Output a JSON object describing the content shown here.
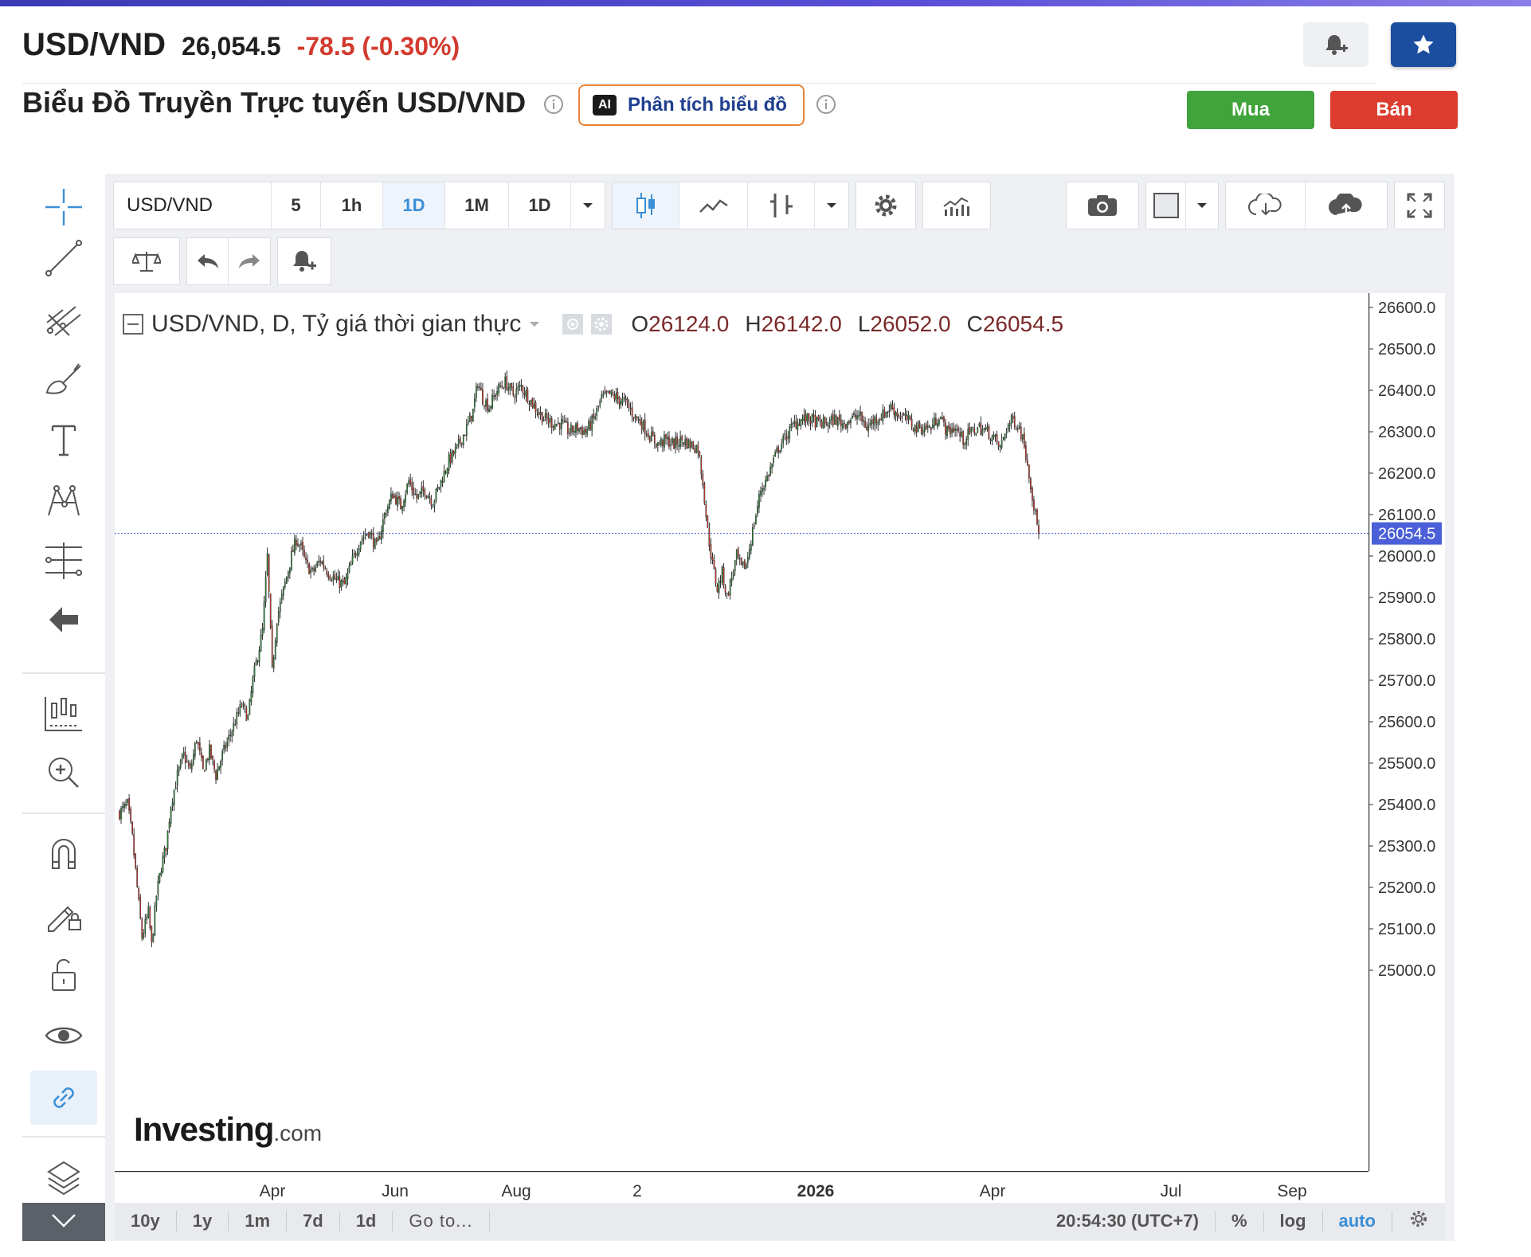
{
  "header": {
    "symbol": "USD/VND",
    "last_price": "26,054.5",
    "change": "-78.5",
    "change_pct": "(-0.30%)"
  },
  "subtitle": "Biểu Đồ Truyền Trực tuyến USD/VND",
  "ai_button": {
    "badge": "AI",
    "label": "Phân tích biểu đồ"
  },
  "actions": {
    "buy": "Mua",
    "sell": "Bán"
  },
  "toolbar": {
    "symbol": "USD/VND",
    "intervals": [
      "5",
      "1h",
      "1D",
      "1M",
      "1D"
    ],
    "selected_interval": "1D"
  },
  "legend": {
    "title": "USD/VND, D, Tỷ giá thời gian thực",
    "o_label": "O",
    "o_value": "26124.0",
    "h_label": "H",
    "h_value": "26142.0",
    "l_label": "L",
    "l_value": "26052.0",
    "c_label": "C",
    "c_value": "26054.5"
  },
  "watermark": {
    "brand": "Investing",
    "suffix": ".com"
  },
  "bottom_bar": {
    "ranges": [
      "10y",
      "1y",
      "1m",
      "7d",
      "1d"
    ],
    "goto": "Go to...",
    "clock": "20:54:30 (UTC+7)",
    "percent": "%",
    "log": "log",
    "auto": "auto"
  },
  "colors": {
    "up": "#2e8b3a",
    "down": "#d23b2e",
    "accent": "#3b5bdb",
    "price_tag": "#4a5fd8"
  },
  "chart_data": {
    "type": "candlestick",
    "symbol": "USD/VND",
    "interval": "D",
    "ylim": [
      24950,
      26650
    ],
    "y_ticks": [
      "26600.0",
      "26500.0",
      "26400.0",
      "26300.0",
      "26200.0",
      "26100.0",
      "26000.0",
      "25900.0",
      "25800.0",
      "25700.0",
      "25600.0",
      "25500.0",
      "25400.0",
      "25300.0",
      "25200.0",
      "25100.0",
      "25000.0"
    ],
    "x_ticks": [
      "Apr",
      "Jun",
      "Aug",
      "2",
      "2026",
      "Apr",
      "Jul",
      "Sep"
    ],
    "last_price_label": "26054.5",
    "last_price": 26054.5,
    "close_path": [
      [
        0,
        25380
      ],
      [
        5,
        25400
      ],
      [
        8,
        25320
      ],
      [
        11,
        25200
      ],
      [
        14,
        25080
      ],
      [
        18,
        25140
      ],
      [
        20,
        25060
      ],
      [
        23,
        25180
      ],
      [
        26,
        25250
      ],
      [
        29,
        25300
      ],
      [
        32,
        25400
      ],
      [
        36,
        25470
      ],
      [
        40,
        25520
      ],
      [
        44,
        25480
      ],
      [
        48,
        25560
      ],
      [
        52,
        25480
      ],
      [
        56,
        25530
      ],
      [
        60,
        25470
      ],
      [
        64,
        25520
      ],
      [
        68,
        25560
      ],
      [
        72,
        25600
      ],
      [
        76,
        25640
      ],
      [
        80,
        25610
      ],
      [
        83,
        25700
      ],
      [
        86,
        25760
      ],
      [
        89,
        25820
      ],
      [
        92,
        26000
      ],
      [
        95,
        25720
      ],
      [
        98,
        25850
      ],
      [
        101,
        25900
      ],
      [
        104,
        25950
      ],
      [
        107,
        26000
      ],
      [
        110,
        26040
      ],
      [
        113,
        26020
      ],
      [
        116,
        25980
      ],
      [
        120,
        25960
      ],
      [
        125,
        25990
      ],
      [
        130,
        25960
      ],
      [
        135,
        25940
      ],
      [
        140,
        25930
      ],
      [
        145,
        25990
      ],
      [
        150,
        26040
      ],
      [
        155,
        26060
      ],
      [
        160,
        26020
      ],
      [
        165,
        26100
      ],
      [
        170,
        26150
      ],
      [
        175,
        26120
      ],
      [
        180,
        26180
      ],
      [
        185,
        26140
      ],
      [
        190,
        26160
      ],
      [
        195,
        26130
      ],
      [
        200,
        26180
      ],
      [
        205,
        26230
      ],
      [
        210,
        26260
      ],
      [
        215,
        26300
      ],
      [
        220,
        26350
      ],
      [
        223,
        26420
      ],
      [
        226,
        26380
      ],
      [
        230,
        26360
      ],
      [
        235,
        26400
      ],
      [
        240,
        26420
      ],
      [
        245,
        26390
      ],
      [
        250,
        26410
      ],
      [
        255,
        26380
      ],
      [
        260,
        26350
      ],
      [
        265,
        26330
      ],
      [
        270,
        26320
      ],
      [
        275,
        26320
      ],
      [
        280,
        26300
      ],
      [
        285,
        26310
      ],
      [
        290,
        26300
      ],
      [
        295,
        26330
      ],
      [
        300,
        26380
      ],
      [
        305,
        26390
      ],
      [
        310,
        26380
      ],
      [
        315,
        26370
      ],
      [
        320,
        26340
      ],
      [
        325,
        26320
      ],
      [
        330,
        26290
      ],
      [
        335,
        26270
      ],
      [
        340,
        26280
      ],
      [
        345,
        26270
      ],
      [
        350,
        26280
      ],
      [
        355,
        26270
      ],
      [
        360,
        26260
      ],
      [
        363,
        26180
      ],
      [
        366,
        26060
      ],
      [
        369,
        25980
      ],
      [
        372,
        25920
      ],
      [
        375,
        25960
      ],
      [
        378,
        25900
      ],
      [
        381,
        25950
      ],
      [
        384,
        26000
      ],
      [
        387,
        25970
      ],
      [
        390,
        25980
      ],
      [
        393,
        26040
      ],
      [
        396,
        26100
      ],
      [
        399,
        26160
      ],
      [
        402,
        26180
      ],
      [
        406,
        26220
      ],
      [
        410,
        26260
      ],
      [
        415,
        26290
      ],
      [
        420,
        26320
      ],
      [
        425,
        26330
      ],
      [
        430,
        26330
      ],
      [
        435,
        26320
      ],
      [
        440,
        26320
      ],
      [
        445,
        26330
      ],
      [
        450,
        26320
      ],
      [
        455,
        26330
      ],
      [
        460,
        26340
      ],
      [
        465,
        26310
      ],
      [
        470,
        26330
      ],
      [
        475,
        26340
      ],
      [
        480,
        26360
      ],
      [
        485,
        26340
      ],
      [
        490,
        26330
      ],
      [
        495,
        26310
      ],
      [
        500,
        26310
      ],
      [
        505,
        26310
      ],
      [
        510,
        26340
      ],
      [
        515,
        26300
      ],
      [
        520,
        26310
      ],
      [
        525,
        26280
      ],
      [
        530,
        26300
      ],
      [
        535,
        26310
      ],
      [
        540,
        26300
      ],
      [
        545,
        26280
      ],
      [
        548,
        26260
      ],
      [
        552,
        26310
      ],
      [
        556,
        26330
      ],
      [
        560,
        26310
      ],
      [
        563,
        26270
      ],
      [
        566,
        26200
      ],
      [
        569,
        26120
      ],
      [
        572,
        26054.5
      ]
    ]
  }
}
